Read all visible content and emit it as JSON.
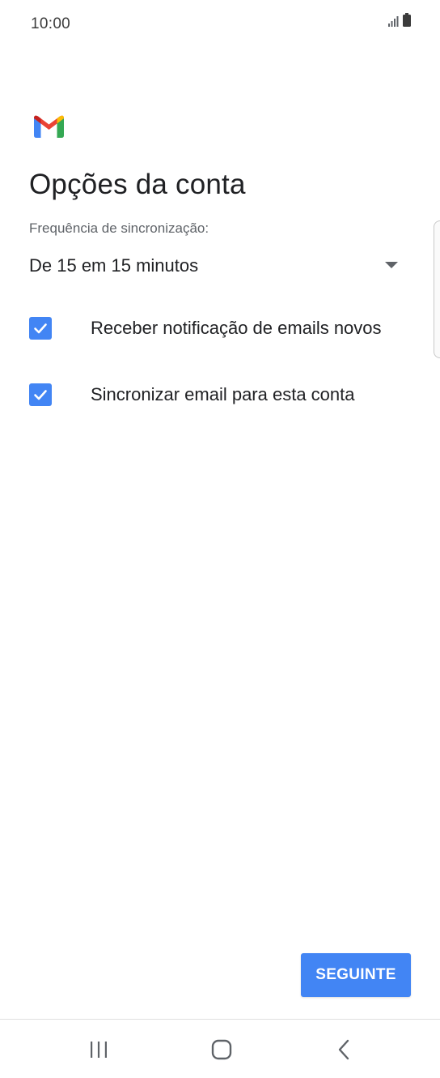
{
  "status_bar": {
    "time": "10:00",
    "icons": [
      "signal-icon",
      "battery-icon"
    ]
  },
  "app": {
    "logo": "gmail-logo"
  },
  "page": {
    "title": "Opções da conta"
  },
  "sync": {
    "label": "Frequência de sincronização:",
    "selected": "De 15 em 15 minutos"
  },
  "options": [
    {
      "label": "Receber notificação de emails novos",
      "checked": true
    },
    {
      "label": "Sincronizar email para esta conta",
      "checked": true
    }
  ],
  "actions": {
    "next_label": "SEGUINTE"
  },
  "nav": {
    "items": [
      "recents-icon",
      "home-icon",
      "back-icon"
    ]
  },
  "colors": {
    "accent": "#4285f4",
    "text_primary": "#202124",
    "text_secondary": "#5f6368"
  }
}
